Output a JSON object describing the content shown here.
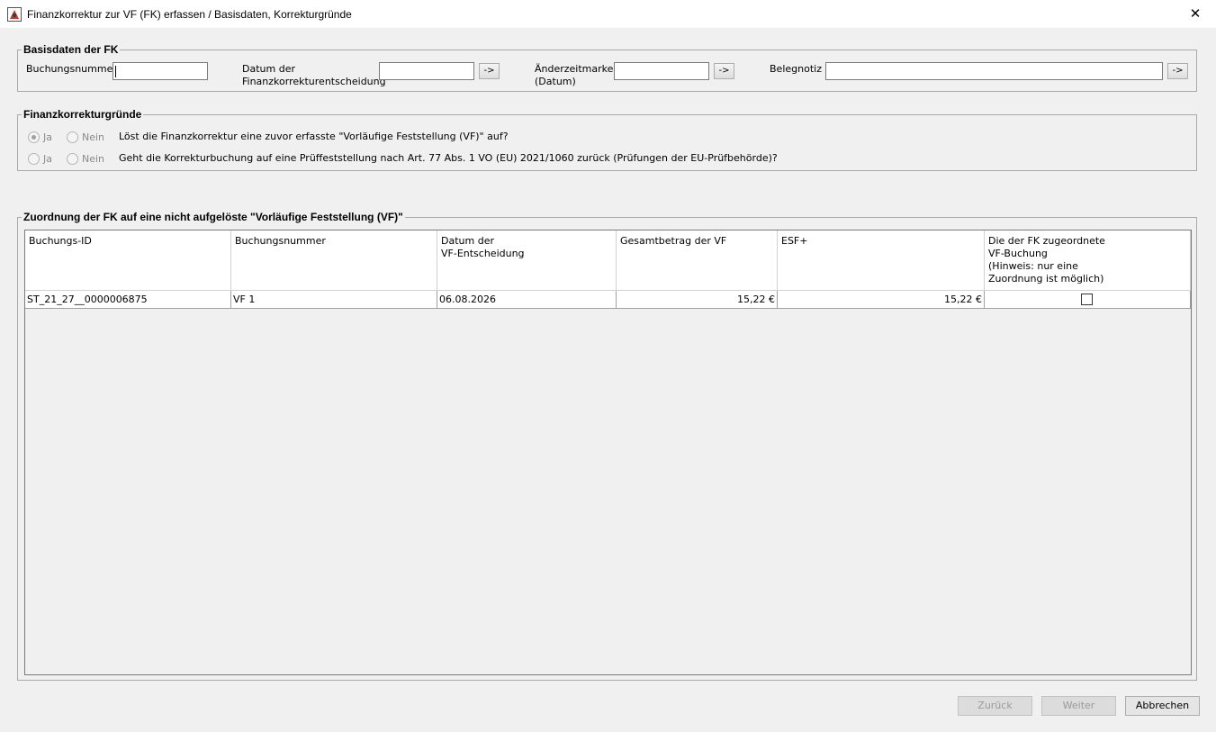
{
  "window": {
    "title": "Finanzkorrektur zur VF (FK) erfassen / Basisdaten, Korrekturgründe",
    "close_glyph": "✕"
  },
  "basisdaten": {
    "legend": "Basisdaten der FK",
    "buchungsnummer_label": "Buchungsnummer",
    "buchungsnummer_value": "",
    "datum_label_1": "Datum der",
    "datum_label_2": "Finanzkorrekturentscheidung",
    "datum_value": "",
    "aenderung_label_1": "Änderzeitmarke",
    "aenderung_label_2": "(Datum)",
    "aenderung_value": "",
    "belegnotiz_label": "Belegnotiz",
    "belegnotiz_value": "",
    "arrow_label": "->"
  },
  "gruende": {
    "legend": "Finanzkorrekturgründe",
    "ja": "Ja",
    "nein": "Nein",
    "q1": "Löst die Finanzkorrektur eine zuvor erfasste \"Vorläufige Feststellung (VF)\" auf?",
    "q1_selected": "Ja",
    "q2": "Geht die Korrekturbuchung auf eine Prüffeststellung nach Art. 77 Abs. 1 VO (EU) 2021/1060 zurück (Prüfungen der EU-Prüfbehörde)?",
    "q2_selected": ""
  },
  "zuordnung": {
    "legend": "Zuordnung der FK auf eine nicht aufgelöste \"Vorläufige Feststellung (VF)\"",
    "headers": {
      "buchungs_id": "Buchungs-ID",
      "buchungsnummer": "Buchungsnummer",
      "datum_1": "Datum der",
      "datum_2": "VF-Entscheidung",
      "gesamtbetrag": "Gesamtbetrag der VF",
      "esf": "ESF+",
      "zuordnung_1": "Die der FK zugeordnete",
      "zuordnung_2": "VF-Buchung",
      "zuordnung_3": "(Hinweis: nur eine",
      "zuordnung_4": "Zuordnung ist möglich)"
    },
    "rows": [
      {
        "buchungs_id": "ST_21_27__0000006875",
        "buchungsnummer": "VF 1",
        "datum": "06.08.2026",
        "gesamtbetrag": "15,22 €",
        "esf": "15,22 €",
        "zugeordnet": false
      }
    ]
  },
  "footer": {
    "zurueck": "Zurück",
    "weiter": "Weiter",
    "abbrechen": "Abbrechen"
  }
}
